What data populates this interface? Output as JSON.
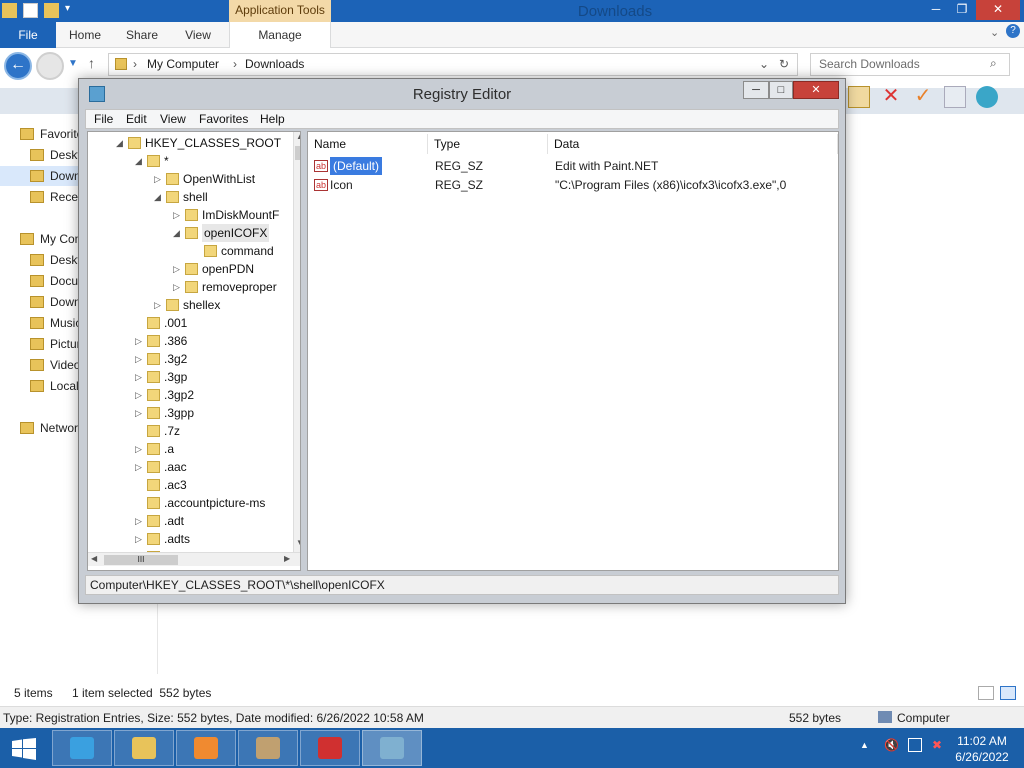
{
  "explorer": {
    "title": "Downloads",
    "context_tab": "Application Tools",
    "ribbon_tabs": [
      "File",
      "Home",
      "Share",
      "View",
      "Manage"
    ],
    "address": [
      "My Computer",
      "Downloads"
    ],
    "search_placeholder": "Search Downloads",
    "sidebar": [
      {
        "label": "Favorites",
        "icon": "star-icon",
        "indent": 0
      },
      {
        "label": "Desktop",
        "icon": "desktop-icon",
        "indent": 1
      },
      {
        "label": "Downloads",
        "icon": "downloads-folder-icon",
        "indent": 1,
        "selected": true
      },
      {
        "label": "Recent places",
        "icon": "recent-places-icon",
        "indent": 1
      },
      {
        "label": "My Computer",
        "icon": "computer-icon",
        "indent": 0
      },
      {
        "label": "Desktop",
        "icon": "folder-icon",
        "indent": 1
      },
      {
        "label": "Documents",
        "icon": "folder-icon",
        "indent": 1
      },
      {
        "label": "Downloads",
        "icon": "folder-icon",
        "indent": 1
      },
      {
        "label": "Music",
        "icon": "folder-icon",
        "indent": 1
      },
      {
        "label": "Pictures",
        "icon": "folder-icon",
        "indent": 1
      },
      {
        "label": "Videos",
        "icon": "folder-icon",
        "indent": 1
      },
      {
        "label": "Local Disk",
        "icon": "drive-icon",
        "indent": 1
      },
      {
        "label": "Network",
        "icon": "network-icon",
        "indent": 0
      }
    ],
    "status": {
      "items": "5 items",
      "selected": "1 item selected  552 bytes"
    },
    "details": {
      "type": "Type: Registration Entries, Size: 552 bytes, Date modified: 6/26/2022 10:58 AM",
      "size": "552 bytes",
      "location": "Computer"
    }
  },
  "regedit": {
    "title": "Registry Editor",
    "menu": [
      "File",
      "Edit",
      "View",
      "Favorites",
      "Help"
    ],
    "tree": [
      {
        "label": "HKEY_CLASSES_ROOT",
        "level": 0,
        "arrow": "expanded"
      },
      {
        "label": "*",
        "level": 1,
        "arrow": "expanded"
      },
      {
        "label": "OpenWithList",
        "level": 2,
        "arrow": "collapsed"
      },
      {
        "label": "shell",
        "level": 2,
        "arrow": "expanded"
      },
      {
        "label": "ImDiskMountF",
        "level": 3,
        "arrow": "collapsed"
      },
      {
        "label": "openICOFX",
        "level": 3,
        "arrow": "expanded",
        "selected": true
      },
      {
        "label": "command",
        "level": 4,
        "arrow": "none"
      },
      {
        "label": "openPDN",
        "level": 3,
        "arrow": "collapsed"
      },
      {
        "label": "removeproper",
        "level": 3,
        "arrow": "collapsed"
      },
      {
        "label": "shellex",
        "level": 2,
        "arrow": "collapsed"
      },
      {
        "label": ".001",
        "level": 1,
        "arrow": "none"
      },
      {
        "label": ".386",
        "level": 1,
        "arrow": "collapsed"
      },
      {
        "label": ".3g2",
        "level": 1,
        "arrow": "collapsed"
      },
      {
        "label": ".3gp",
        "level": 1,
        "arrow": "collapsed"
      },
      {
        "label": ".3gp2",
        "level": 1,
        "arrow": "collapsed"
      },
      {
        "label": ".3gpp",
        "level": 1,
        "arrow": "collapsed"
      },
      {
        "label": ".7z",
        "level": 1,
        "arrow": "none"
      },
      {
        "label": ".a",
        "level": 1,
        "arrow": "collapsed"
      },
      {
        "label": ".aac",
        "level": 1,
        "arrow": "collapsed"
      },
      {
        "label": ".ac3",
        "level": 1,
        "arrow": "none"
      },
      {
        "label": ".accountpicture-ms",
        "level": 1,
        "arrow": "none"
      },
      {
        "label": ".adt",
        "level": 1,
        "arrow": "collapsed"
      },
      {
        "label": ".adts",
        "level": 1,
        "arrow": "collapsed"
      },
      {
        "label": ".ai",
        "level": 1,
        "arrow": "collapsed"
      }
    ],
    "columns": [
      "Name",
      "Type",
      "Data"
    ],
    "values": [
      {
        "name": "(Default)",
        "type": "REG_SZ",
        "data": "Edit with Paint.NET",
        "selected": true
      },
      {
        "name": "Icon",
        "type": "REG_SZ",
        "data": "\"C:\\Program Files (x86)\\icofx3\\icofx3.exe\",0"
      }
    ],
    "status_path": "Computer\\HKEY_CLASSES_ROOT\\*\\shell\\openICOFX",
    "hscroll_glyph": "III"
  },
  "taskbar": {
    "time": "11:02 AM",
    "date": "6/26/2022",
    "apps": [
      "internet-explorer-icon",
      "file-explorer-icon",
      "media-player-icon",
      "user-app-icon",
      "ruby-cube-icon",
      "registry-editor-icon"
    ]
  },
  "colors": {
    "titlebar": "#1c63b7",
    "taskbar": "#1b5fa8",
    "selection": "#3a7be0",
    "folder": "#f2d67a"
  }
}
